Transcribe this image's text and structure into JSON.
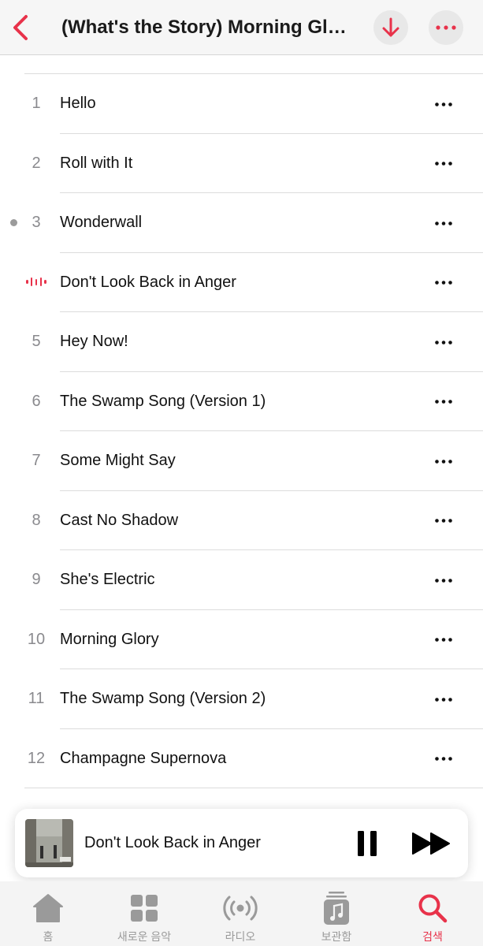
{
  "header": {
    "title": "(What's the Story) Morning Glory?",
    "back_icon": "chevron-left-icon",
    "download_icon": "arrow-down-icon",
    "more_icon": "ellipsis-icon",
    "accent_color": "#e8324a"
  },
  "tracks": [
    {
      "number": "1",
      "title": "Hello"
    },
    {
      "number": "2",
      "title": "Roll with It"
    },
    {
      "number": "3",
      "title": "Wonderwall",
      "played": true
    },
    {
      "number": "",
      "title": "Don't Look Back in Anger",
      "now_playing": true
    },
    {
      "number": "5",
      "title": "Hey Now!"
    },
    {
      "number": "6",
      "title": "The Swamp Song (Version 1)"
    },
    {
      "number": "7",
      "title": "Some Might Say"
    },
    {
      "number": "8",
      "title": "Cast No Shadow"
    },
    {
      "number": "9",
      "title": "She's Electric"
    },
    {
      "number": "10",
      "title": "Morning Glory"
    },
    {
      "number": "11",
      "title": "The Swamp Song (Version 2)"
    },
    {
      "number": "12",
      "title": "Champagne Supernova"
    }
  ],
  "mini_player": {
    "title": "Don't Look Back in Anger",
    "artwork_icon": "album-artwork",
    "pause_icon": "pause-icon",
    "forward_icon": "fast-forward-icon"
  },
  "tabs": [
    {
      "label": "홈",
      "icon": "home-icon",
      "active": false
    },
    {
      "label": "새로운 음악",
      "icon": "grid-icon",
      "active": false
    },
    {
      "label": "라디오",
      "icon": "radio-icon",
      "active": false
    },
    {
      "label": "보관함",
      "icon": "library-icon",
      "active": false
    },
    {
      "label": "검색",
      "icon": "search-icon",
      "active": true
    }
  ]
}
